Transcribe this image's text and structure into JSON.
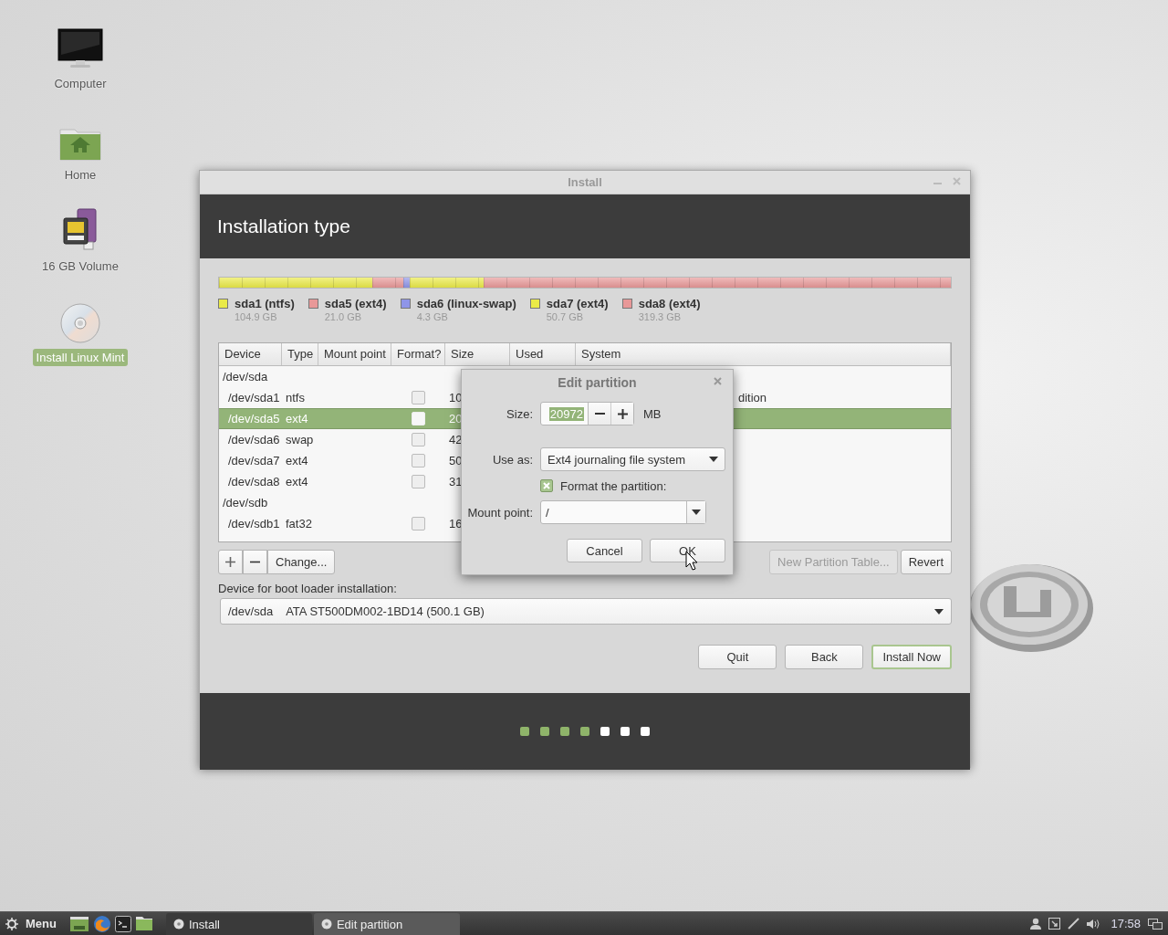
{
  "desktop_icons": [
    {
      "kind": "computer",
      "label": "Computer",
      "selected": false
    },
    {
      "kind": "home",
      "label": "Home",
      "selected": false
    },
    {
      "kind": "volume",
      "label": "16 GB Volume",
      "selected": false
    },
    {
      "kind": "disc",
      "label": "Install Linux Mint",
      "selected": true
    }
  ],
  "install_window": {
    "title": "Install",
    "heading": "Installation type",
    "partitions": [
      {
        "name": "sda1 (ntfs)",
        "size": "104.9 GB",
        "color": "#eaea48"
      },
      {
        "name": "sda5 (ext4)",
        "size": "21.0 GB",
        "color": "#e89898"
      },
      {
        "name": "sda6 (linux-swap)",
        "size": "4.3 GB",
        "color": "#8f95e8"
      },
      {
        "name": "sda7 (ext4)",
        "size": "50.7 GB",
        "color": "#eaea48"
      },
      {
        "name": "sda8 (ext4)",
        "size": "319.3 GB",
        "color": "#e89898"
      }
    ],
    "table": {
      "columns": [
        "Device",
        "Type",
        "Mount point",
        "Format?",
        "Size",
        "Used",
        "System"
      ],
      "rows": [
        {
          "kind": "disk",
          "device": "/dev/sda",
          "selected": false
        },
        {
          "kind": "partition",
          "device": "/dev/sda1",
          "type": "ntfs",
          "format": false,
          "size": "10",
          "system": "dition",
          "selected": false
        },
        {
          "kind": "partition",
          "device": "/dev/sda5",
          "type": "ext4",
          "format": false,
          "size": "20",
          "selected": true
        },
        {
          "kind": "partition",
          "device": "/dev/sda6",
          "type": "swap",
          "format": false,
          "size": "42",
          "selected": false
        },
        {
          "kind": "partition",
          "device": "/dev/sda7",
          "type": "ext4",
          "format": false,
          "size": "50",
          "selected": false
        },
        {
          "kind": "partition",
          "device": "/dev/sda8",
          "type": "ext4",
          "format": false,
          "size": "31",
          "selected": false
        },
        {
          "kind": "disk",
          "device": "/dev/sdb",
          "selected": false
        },
        {
          "kind": "partition",
          "device": "/dev/sdb1",
          "type": "fat32",
          "format": false,
          "size": "16",
          "selected": false
        }
      ]
    },
    "change_button": "Change...",
    "new_table_button": {
      "label": "New Partition Table...",
      "disabled": true
    },
    "revert_button": {
      "label": "Revert",
      "disabled": false
    },
    "boot_loader_label": "Device for boot loader installation:",
    "boot_loader_device": {
      "device": "/dev/sda",
      "description": "ATA ST500DM002-1BD14 (500.1 GB)"
    },
    "nav_buttons": [
      {
        "label": "Quit",
        "default": false
      },
      {
        "label": "Back",
        "default": false
      },
      {
        "label": "Install Now",
        "default": true
      }
    ],
    "progress_steps": [
      {
        "done": true
      },
      {
        "done": true
      },
      {
        "done": true
      },
      {
        "done": true
      },
      {
        "done": false
      },
      {
        "done": false
      },
      {
        "done": false
      }
    ]
  },
  "edit_dialog": {
    "title": "Edit partition",
    "size_label": "Size:",
    "size": "20972",
    "unit": "MB",
    "use_as_label": "Use as:",
    "use_as": "Ext4 journaling file system",
    "format_label": "Format the partition:",
    "format": true,
    "mount_label": "Mount point:",
    "mount_point": "/",
    "buttons": [
      "Cancel",
      "OK"
    ]
  },
  "taskbar": {
    "menu": "Menu",
    "windows": [
      {
        "label": "Install",
        "selected": false
      },
      {
        "label": "Edit partition",
        "selected": true
      }
    ],
    "clock": "17:58"
  }
}
